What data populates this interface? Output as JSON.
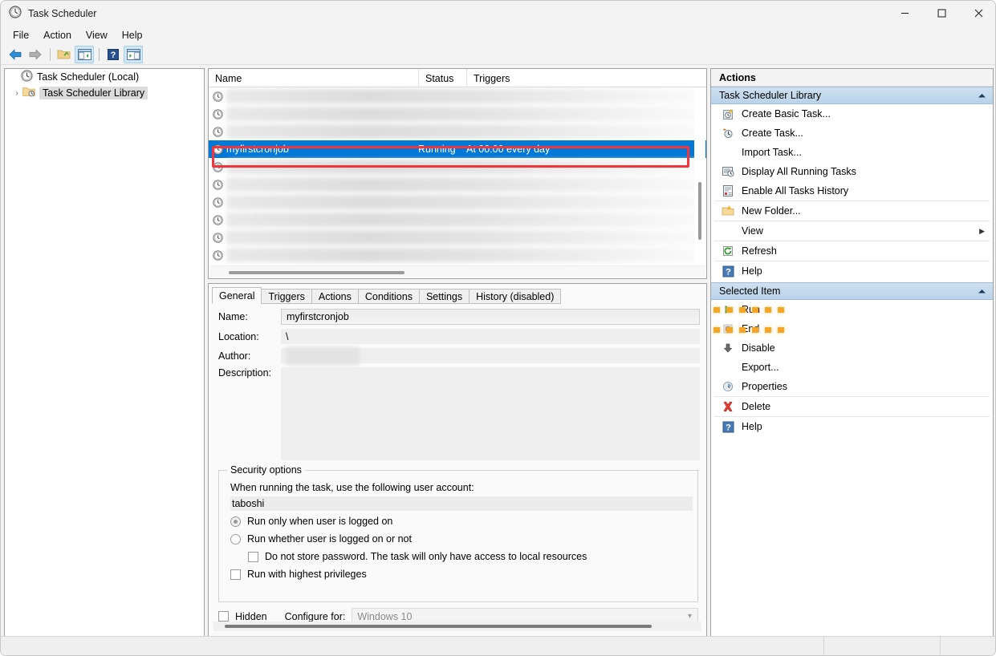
{
  "window": {
    "title": "Task Scheduler",
    "icon": "clock-icon",
    "controls": {
      "minimize": "minimize-icon",
      "maximize": "maximize-icon",
      "close": "close-icon"
    }
  },
  "menubar": {
    "items": [
      "File",
      "Action",
      "View",
      "Help"
    ]
  },
  "toolbar": {
    "buttons": [
      {
        "name": "back-button",
        "icon": "back-arrow-icon",
        "active": false
      },
      {
        "name": "forward-button",
        "icon": "forward-arrow-icon",
        "active": false
      },
      {
        "name": "up-one-level-button",
        "icon": "folder-up-icon",
        "active": false
      },
      {
        "name": "show-console-tree-button",
        "icon": "console-tree-icon",
        "active": true
      },
      {
        "name": "help-button",
        "icon": "question-mark-icon",
        "active": false
      },
      {
        "name": "show-action-pane-button",
        "icon": "action-pane-icon",
        "active": true
      }
    ]
  },
  "tree": {
    "items": [
      {
        "label": "Task Scheduler (Local)",
        "icon": "clock-icon",
        "expander": "",
        "selected": false
      },
      {
        "label": "Task Scheduler Library",
        "icon": "folder-clock-icon",
        "expander": "›",
        "selected": true
      }
    ]
  },
  "task_list": {
    "columns": [
      "Name",
      "Status",
      "Triggers"
    ],
    "rows": [
      {
        "name": "",
        "status": "",
        "triggers": "",
        "blurred": true,
        "selected": false
      },
      {
        "name": "",
        "status": "",
        "triggers": "",
        "blurred": true,
        "selected": false
      },
      {
        "name": "",
        "status": "",
        "triggers": "",
        "blurred": true,
        "selected": false
      },
      {
        "name": "myfirstcronjob",
        "status": "Running",
        "triggers": "At 00:00 every day",
        "blurred": false,
        "selected": true
      },
      {
        "name": "",
        "status": "",
        "triggers": "",
        "blurred": true,
        "selected": false
      },
      {
        "name": "",
        "status": "",
        "triggers": "",
        "blurred": true,
        "selected": false
      },
      {
        "name": "",
        "status": "",
        "triggers": "",
        "blurred": true,
        "selected": false
      },
      {
        "name": "",
        "status": "",
        "triggers": "",
        "blurred": true,
        "selected": false
      },
      {
        "name": "",
        "status": "",
        "triggers": "",
        "blurred": true,
        "selected": false
      },
      {
        "name": "",
        "status": "",
        "triggers": "",
        "blurred": true,
        "selected": false
      }
    ]
  },
  "annotations": {
    "selected_row_box_color": "#f4333a",
    "refresh_highlight_color": "#f5a623"
  },
  "details": {
    "tabs": [
      {
        "label": "General",
        "active": true
      },
      {
        "label": "Triggers",
        "active": false
      },
      {
        "label": "Actions",
        "active": false
      },
      {
        "label": "Conditions",
        "active": false
      },
      {
        "label": "Settings",
        "active": false
      },
      {
        "label": "History (disabled)",
        "active": false
      }
    ],
    "fields": {
      "name_label": "Name:",
      "name_value": "myfirstcronjob",
      "location_label": "Location:",
      "location_value": "\\",
      "author_label": "Author:",
      "author_value": "",
      "description_label": "Description:",
      "description_value": ""
    },
    "security": {
      "group_title": "Security options",
      "prompt": "When running the task, use the following user account:",
      "account": "taboshi",
      "options": [
        {
          "label": "Run only when user is logged on",
          "type": "radio",
          "checked": true
        },
        {
          "label": "Run whether user is logged on or not",
          "type": "radio",
          "checked": false
        },
        {
          "label": "Do not store password.  The task will only have access to local resources",
          "type": "checkbox",
          "checked": false,
          "sub": true
        },
        {
          "label": "Run with highest privileges",
          "type": "checkbox",
          "checked": false
        }
      ]
    },
    "bottom": {
      "hidden_label": "Hidden",
      "hidden_checked": false,
      "configure_label": "Configure for:",
      "configure_value": "Windows 10"
    }
  },
  "actions": {
    "title": "Actions",
    "sections": [
      {
        "title": "Task Scheduler Library",
        "collapse_icon": "chevron-up-icon",
        "items": [
          {
            "label": "Create Basic Task...",
            "icon": "create-basic-task-icon",
            "separator_after": false,
            "highlight": false,
            "submenu": false
          },
          {
            "label": "Create Task...",
            "icon": "create-task-icon",
            "separator_after": false,
            "highlight": false,
            "submenu": false
          },
          {
            "label": "Import Task...",
            "icon": "",
            "separator_after": false,
            "highlight": false,
            "submenu": false
          },
          {
            "label": "Display All Running Tasks",
            "icon": "display-running-tasks-icon",
            "separator_after": false,
            "highlight": false,
            "submenu": false
          },
          {
            "label": "Enable All Tasks History",
            "icon": "tasks-history-icon",
            "separator_after": true,
            "highlight": false,
            "submenu": false
          },
          {
            "label": "New Folder...",
            "icon": "new-folder-icon",
            "separator_after": true,
            "highlight": false,
            "submenu": false
          },
          {
            "label": "View",
            "icon": "",
            "separator_after": true,
            "highlight": false,
            "submenu": true
          },
          {
            "label": "Refresh",
            "icon": "refresh-icon",
            "separator_after": true,
            "highlight": true,
            "submenu": false
          },
          {
            "label": "Help",
            "icon": "question-mark-icon",
            "separator_after": false,
            "highlight": false,
            "submenu": false
          }
        ]
      },
      {
        "title": "Selected Item",
        "collapse_icon": "chevron-up-icon",
        "items": [
          {
            "label": "Run",
            "icon": "run-play-icon",
            "separator_after": false,
            "highlight": false,
            "submenu": false
          },
          {
            "label": "End",
            "icon": "stop-square-icon",
            "separator_after": false,
            "highlight": false,
            "submenu": false
          },
          {
            "label": "Disable",
            "icon": "down-arrow-icon",
            "separator_after": false,
            "highlight": false,
            "submenu": false
          },
          {
            "label": "Export...",
            "icon": "",
            "separator_after": false,
            "highlight": false,
            "submenu": false
          },
          {
            "label": "Properties",
            "icon": "properties-clock-icon",
            "separator_after": true,
            "highlight": false,
            "submenu": false
          },
          {
            "label": "Delete",
            "icon": "delete-x-icon",
            "separator_after": true,
            "highlight": false,
            "submenu": false
          },
          {
            "label": "Help",
            "icon": "question-mark-icon",
            "separator_after": false,
            "highlight": false,
            "submenu": false
          }
        ]
      }
    ]
  },
  "statusbar": {
    "text": ""
  }
}
